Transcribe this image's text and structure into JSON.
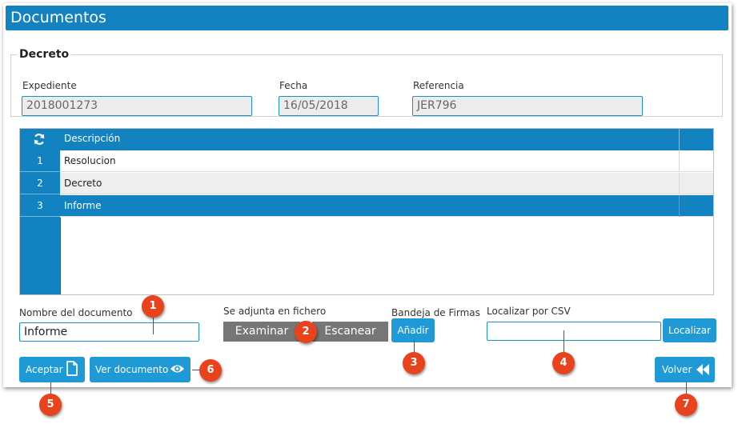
{
  "window": {
    "title": "Documentos"
  },
  "decreto": {
    "legend": "Decreto",
    "expediente_label": "Expediente",
    "expediente_value": "2018001273",
    "fecha_label": "Fecha",
    "fecha_value": "16/05/2018",
    "referencia_label": "Referencia",
    "referencia_value": "JER796"
  },
  "grid": {
    "refresh_icon": "refresh-icon",
    "column_header": "Descripción",
    "rows": [
      {
        "num": "1",
        "descripcion": "Resolucion"
      },
      {
        "num": "2",
        "descripcion": "Decreto"
      },
      {
        "num": "3",
        "descripcion": "Informe"
      }
    ]
  },
  "form": {
    "nombre_label": "Nombre del documento",
    "nombre_value": "Informe",
    "adjunta_label": "Se adjunta en fichero",
    "examinar_label": "Examinar",
    "escanear_label": "Escanear",
    "bandeja_label": "Bandeja de Firmas",
    "anadir_label": "Añadir",
    "csv_label": "Localizar por CSV",
    "csv_value": "",
    "localizar_label": "Localizar"
  },
  "buttons": {
    "aceptar_label": "Aceptar",
    "aceptar_icon": "document-icon",
    "ver_label": "Ver documento",
    "ver_icon": "eye-icon",
    "volver_label": "Volver",
    "volver_icon": "rewind-icon"
  },
  "callouts": [
    "1",
    "2",
    "3",
    "4",
    "5",
    "6",
    "7"
  ],
  "colors": {
    "primary": "#1282c0",
    "button": "#1f9ad6",
    "badge": "#e8431c",
    "scan_button": "#767676"
  }
}
